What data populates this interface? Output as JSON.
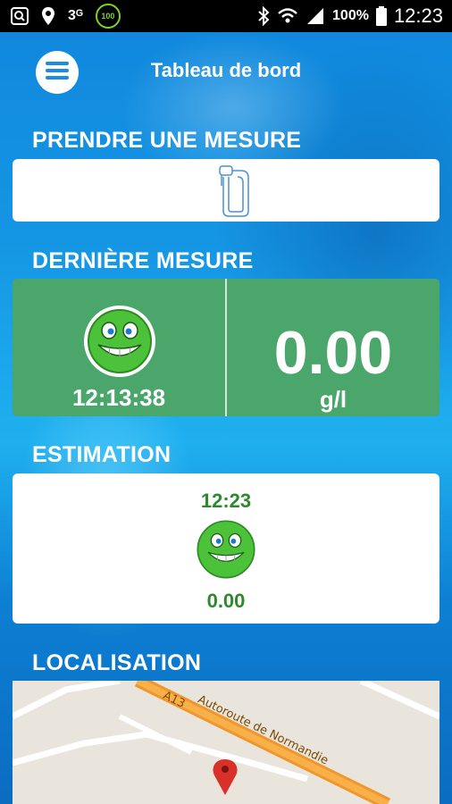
{
  "status_bar": {
    "network": "3ᴳ",
    "battery_badge": "100",
    "battery_percent": "100%",
    "clock": "12:23",
    "icons": [
      "search-icon",
      "location-icon",
      "bluetooth-icon",
      "wifi-icon",
      "signal-icon",
      "battery-icon"
    ]
  },
  "header": {
    "title": "Tableau de bord",
    "menu_icon": "hamburger-menu-icon"
  },
  "sections": {
    "measure": {
      "title": "PRENDRE UNE MESURE",
      "icon": "breathalyzer-icon"
    },
    "last_measure": {
      "title": "DERNIÈRE MESURE",
      "time": "12:13:38",
      "value": "0.00",
      "unit": "g/l",
      "icon": "smiley-icon"
    },
    "estimation": {
      "title": "ESTIMATION",
      "time": "12:23",
      "value": "0.00",
      "icon": "smiley-icon"
    },
    "location": {
      "title": "LOCALISATION",
      "road_code": "A13",
      "road_name": "Autoroute de Normandie",
      "icon": "map-pin-icon"
    }
  },
  "colors": {
    "green_card": "#4aa66b",
    "green_text": "#2c8a2c",
    "road": "#f3a23a",
    "pin": "#d9302a"
  }
}
